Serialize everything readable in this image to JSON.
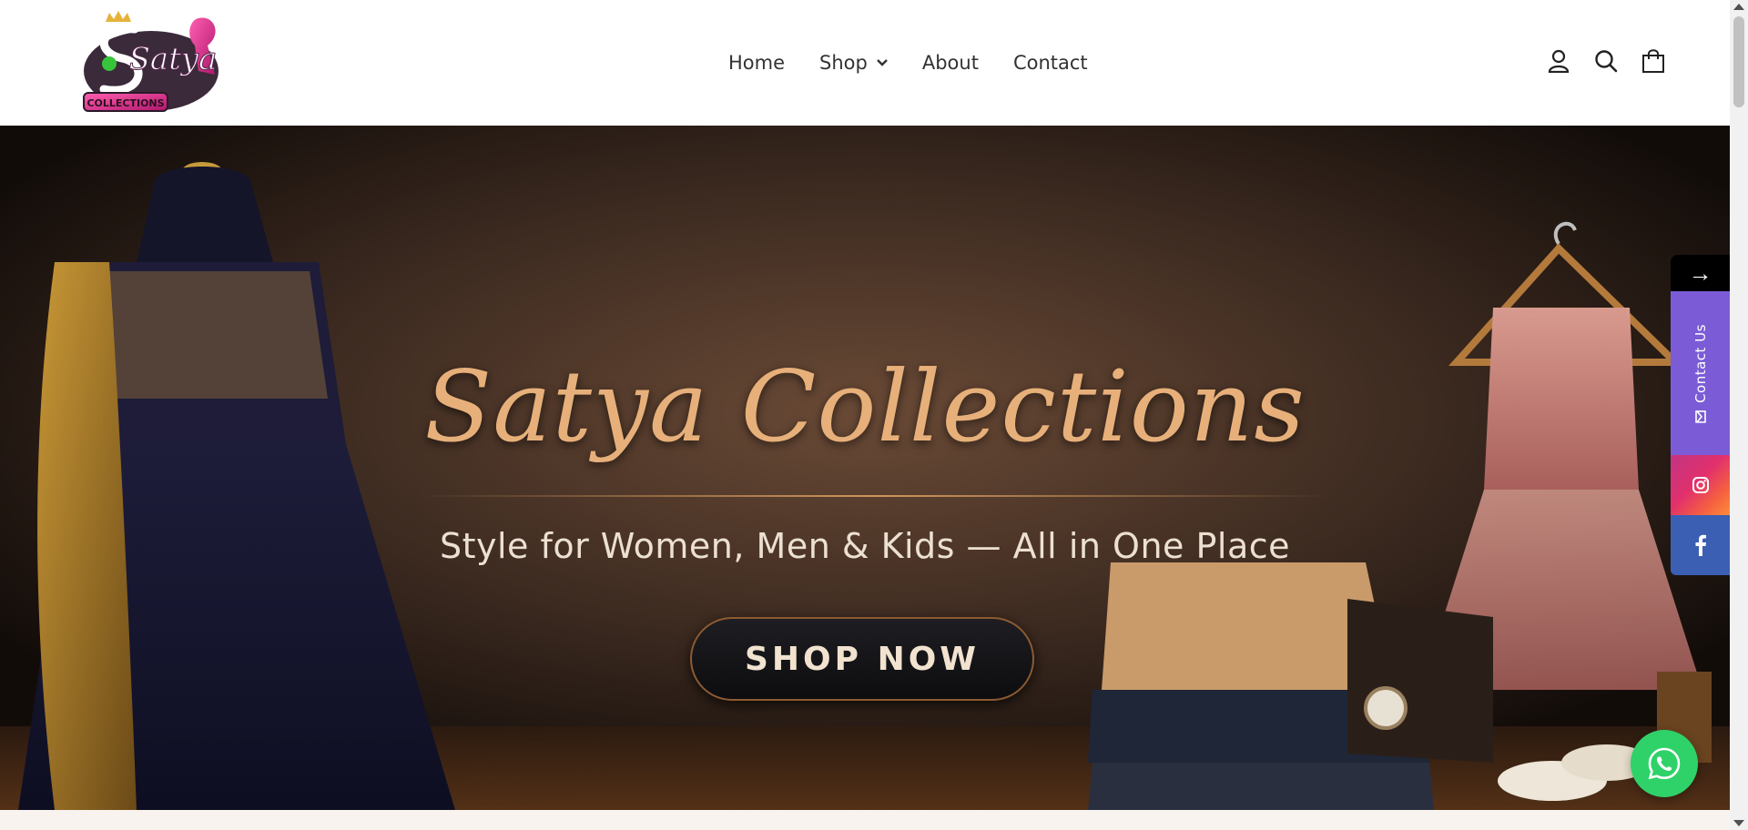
{
  "header": {
    "logo_text": "Satya",
    "logo_sub": "COLLECTIONS",
    "nav": [
      {
        "label": "Home"
      },
      {
        "label": "Shop"
      },
      {
        "label": "About"
      },
      {
        "label": "Contact"
      }
    ],
    "icons": [
      "user-icon",
      "search-icon",
      "cart-icon"
    ]
  },
  "hero": {
    "title": "Satya Collections",
    "subtitle": "Style for Women, Men & Kids — All in One Place",
    "cta_label": "SHOP NOW"
  },
  "side_social": {
    "arrow": "→",
    "contact_label": "Contact Us",
    "items": [
      "instagram-icon",
      "facebook-icon"
    ]
  },
  "whatsapp": {
    "icon": "whatsapp-icon"
  },
  "colors": {
    "brand_pink": "#e83e8c",
    "gold_title": "#e7b07a",
    "contact_purple": "#7b5cd6",
    "facebook_blue": "#3b5fb3",
    "whatsapp_green": "#2fd268"
  }
}
